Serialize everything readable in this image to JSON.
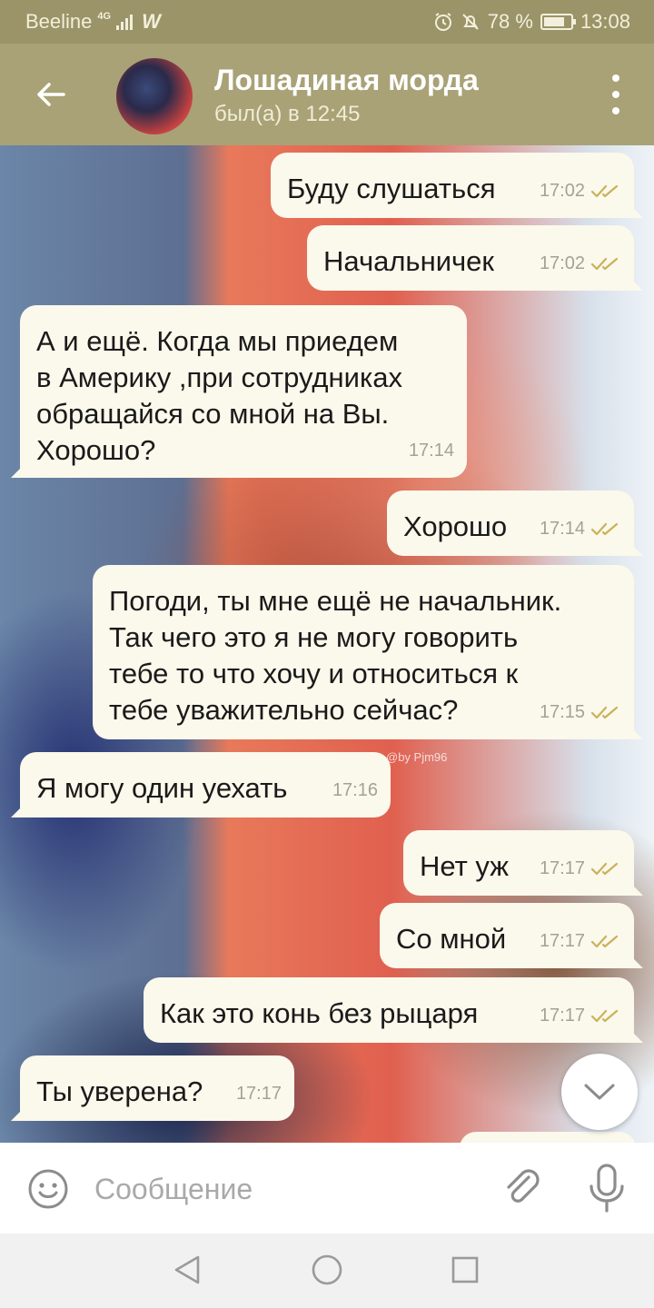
{
  "status_bar": {
    "carrier": "Beeline",
    "network": "4G",
    "battery": "78 %",
    "battery_level": 0.78,
    "time": "13:08",
    "icons": [
      "signal-icon",
      "app-icon",
      "alarm-icon",
      "mute-icon",
      "battery-icon"
    ]
  },
  "header": {
    "title": "Лошадиная морда",
    "subtitle": "был(а) в 12:45",
    "icons": [
      "back-arrow-icon",
      "avatar",
      "more-vert-icon"
    ]
  },
  "chat": {
    "watermark": "@by Pjm96",
    "messages": [
      {
        "dir": "out",
        "text": [
          "Буду слушаться"
        ],
        "time": "17:02",
        "read": true
      },
      {
        "dir": "out",
        "text": [
          "Начальничек"
        ],
        "time": "17:02",
        "read": true
      },
      {
        "dir": "in",
        "text": [
          "А и ещё. Когда мы приедем",
          "в Америку ,при сотрудниках",
          "обращайся со мной на Вы.",
          "Хорошо?"
        ],
        "time": "17:14"
      },
      {
        "dir": "out",
        "text": [
          "Хорошо"
        ],
        "time": "17:14",
        "read": true
      },
      {
        "dir": "out",
        "text": [
          "Погоди, ты мне ещё не начальник.",
          "Так чего это я не могу говорить",
          "тебе то что хочу и относиться к",
          "тебе уважительно сейчас?"
        ],
        "time": "17:15",
        "read": true
      },
      {
        "dir": "in",
        "text": [
          "Я могу один уехать"
        ],
        "time": "17:16"
      },
      {
        "dir": "out",
        "text": [
          "Нет уж"
        ],
        "time": "17:17",
        "read": true
      },
      {
        "dir": "out",
        "text": [
          "Со мной"
        ],
        "time": "17:17",
        "read": true
      },
      {
        "dir": "out",
        "text": [
          "Как это конь без рыцаря"
        ],
        "time": "17:17",
        "read": true
      },
      {
        "dir": "in",
        "text": [
          "Ты уверена?"
        ],
        "time": "17:17"
      }
    ]
  },
  "input_bar": {
    "placeholder": "Сообщение",
    "value": "",
    "icons": [
      "emoji-icon",
      "attach-icon",
      "mic-icon"
    ]
  },
  "nav_bar": {
    "icons": [
      "back-triangle-icon",
      "home-circle-icon",
      "recents-square-icon"
    ]
  },
  "colors": {
    "header_bg": "#a8a276",
    "status_bg": "#9a9468",
    "bubble_bg": "#fbf8ec",
    "check_color": "#c9b25a",
    "time_color": "#a5a196"
  }
}
